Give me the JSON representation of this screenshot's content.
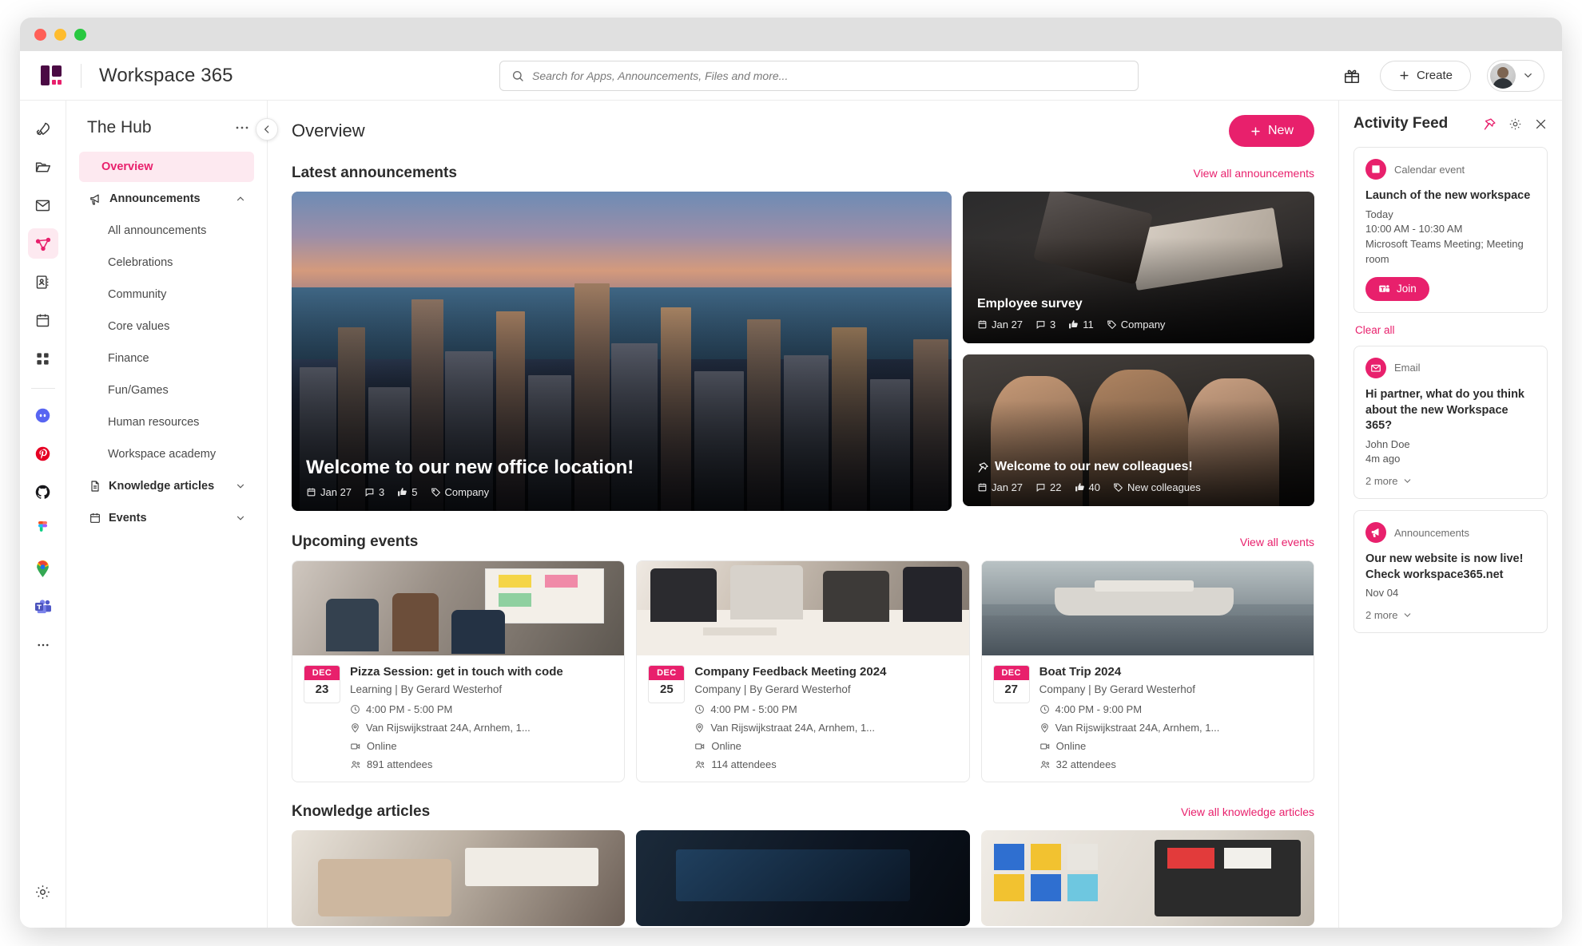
{
  "window": {
    "title": "Workspace 365"
  },
  "topbar": {
    "brand_title": "Workspace 365",
    "search": {
      "placeholder": "Search for Apps, Announcements, Files and more...",
      "value": ""
    },
    "create_label": "Create",
    "gift_icon": "gift-icon",
    "avatar_chevron_icon": "chevron-down-icon"
  },
  "rail": {
    "items": [
      {
        "name": "rocket-icon",
        "active": false
      },
      {
        "name": "folder-icon",
        "active": false
      },
      {
        "name": "mail-icon",
        "active": false
      },
      {
        "name": "share-nodes-icon",
        "active": true
      },
      {
        "name": "contacts-icon",
        "active": false
      },
      {
        "name": "calendar-icon",
        "active": false
      },
      {
        "name": "apps-grid-icon",
        "active": false
      }
    ],
    "apps": [
      {
        "name": "discord-icon"
      },
      {
        "name": "pinterest-icon"
      },
      {
        "name": "github-icon"
      },
      {
        "name": "figma-icon"
      },
      {
        "name": "google-maps-icon"
      },
      {
        "name": "microsoft-teams-icon"
      }
    ],
    "more_label": "...",
    "settings_icon": "gear-icon"
  },
  "hub": {
    "title": "The Hub",
    "menu_icon": "ellipsis-icon",
    "collapse_icon": "chevron-left-icon",
    "items": [
      {
        "label": "Overview",
        "type": "active"
      },
      {
        "label": "Announcements",
        "type": "group",
        "icon": "megaphone-icon",
        "expanded": true
      },
      {
        "label": "All announcements",
        "type": "sub"
      },
      {
        "label": "Celebrations",
        "type": "sub"
      },
      {
        "label": "Community",
        "type": "sub"
      },
      {
        "label": "Core values",
        "type": "sub"
      },
      {
        "label": "Finance",
        "type": "sub"
      },
      {
        "label": "Fun/Games",
        "type": "sub"
      },
      {
        "label": "Human resources",
        "type": "sub"
      },
      {
        "label": "Workspace academy",
        "type": "sub"
      },
      {
        "label": "Knowledge articles",
        "type": "group",
        "icon": "document-icon",
        "expanded": false
      },
      {
        "label": "Events",
        "type": "group",
        "icon": "calendar-icon",
        "expanded": false
      }
    ]
  },
  "main": {
    "page_title": "Overview",
    "new_button": "New",
    "announcements": {
      "heading": "Latest announcements",
      "view_all": "View all announcements",
      "hero": {
        "title": "Welcome to our new office location!",
        "date": "Jan 27",
        "comments": "3",
        "likes": "5",
        "tag": "Company"
      },
      "cards": [
        {
          "title": "Employee survey",
          "date": "Jan 27",
          "comments": "3",
          "likes": "11",
          "tag": "Company",
          "pinned": false
        },
        {
          "title": "Welcome to our new colleagues!",
          "date": "Jan 27",
          "comments": "22",
          "likes": "40",
          "tag": "New colleagues",
          "pinned": true
        }
      ]
    },
    "events": {
      "heading": "Upcoming events",
      "view_all": "View all events",
      "items": [
        {
          "month": "DEC",
          "day": "23",
          "title": "Pizza Session: get in touch with code",
          "subtitle": "Learning | By Gerard Westerhof",
          "time": "4:00 PM - 5:00 PM",
          "location": "Van Rijswijkstraat 24A, Arnhem, 1...",
          "mode": "Online",
          "attendees": "891 attendees"
        },
        {
          "month": "DEC",
          "day": "25",
          "title": "Company Feedback Meeting 2024",
          "subtitle": "Company | By Gerard Westerhof",
          "time": "4:00 PM - 5:00 PM",
          "location": "Van Rijswijkstraat 24A, Arnhem, 1...",
          "mode": "Online",
          "attendees": "114 attendees"
        },
        {
          "month": "DEC",
          "day": "27",
          "title": "Boat Trip 2024",
          "subtitle": "Company | By Gerard Westerhof",
          "time": "4:00 PM - 9:00 PM",
          "location": "Van Rijswijkstraat 24A, Arnhem, 1...",
          "mode": "Online",
          "attendees": "32 attendees"
        }
      ]
    },
    "knowledge": {
      "heading": "Knowledge articles",
      "view_all": "View all knowledge articles"
    }
  },
  "feed": {
    "title": "Activity Feed",
    "pin_icon": "pin-icon",
    "settings_icon": "gear-icon",
    "close_icon": "close-icon",
    "clear_all": "Clear all",
    "items": [
      {
        "kind": "Calendar event",
        "badge_icon": "calendar-icon",
        "title": "Launch of the new workspace",
        "line1": "Today",
        "line2": "10:00 AM - 10:30 AM",
        "line3": "Microsoft Teams Meeting; Meeting room",
        "join_label": "Join",
        "join_icon": "microsoft-teams-icon"
      },
      {
        "kind": "Email",
        "badge_icon": "mail-icon",
        "title": "Hi partner, what do you think about the new Workspace 365?",
        "line1": "John Doe",
        "line2": "4m ago",
        "more": "2 more"
      },
      {
        "kind": "Announcements",
        "badge_icon": "megaphone-icon",
        "title": "Our new website is now live! Check workspace365.net",
        "line1": "Nov 04",
        "more": "2 more"
      }
    ]
  },
  "colors": {
    "accent": "#e8206c",
    "accent_soft": "#fde9f0",
    "brand_purple": "#4b0a44",
    "text": "#2c2c2c",
    "border": "#e6e6e6"
  }
}
